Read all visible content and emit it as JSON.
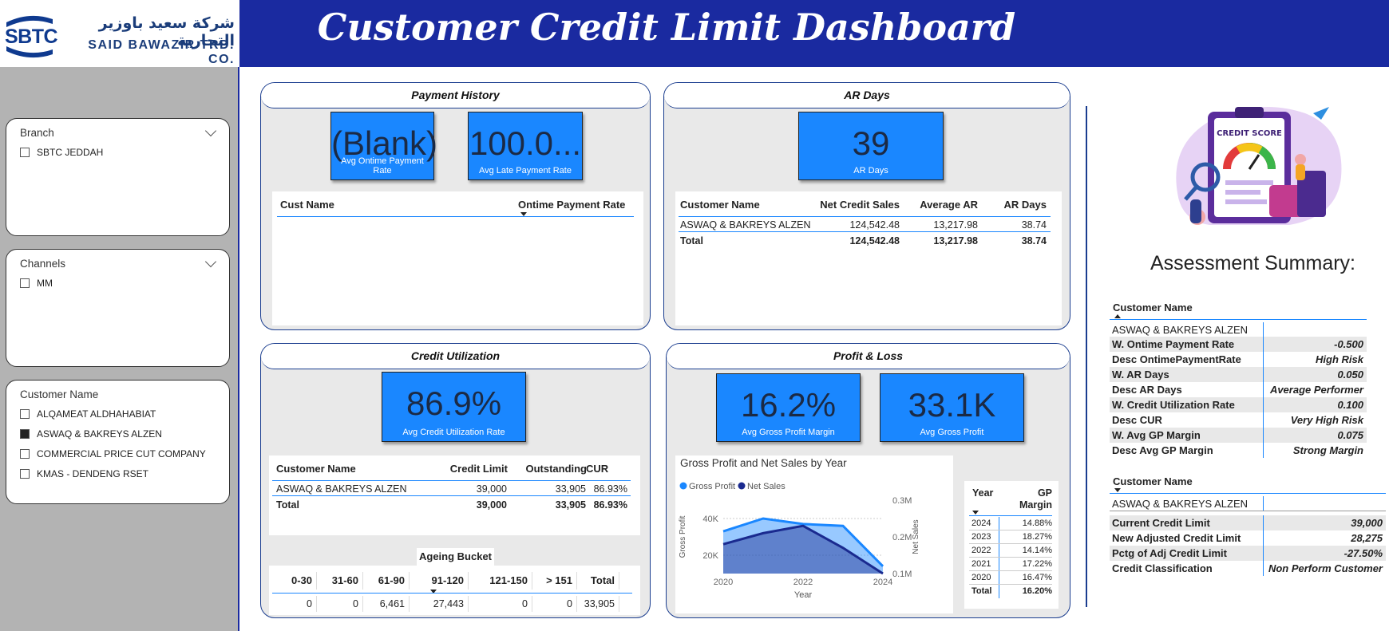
{
  "header": {
    "title": "Customer Credit Limit Dashboard",
    "logo_short": "SBTC",
    "logo_arabic": "شركة سعيد باوزير التجارية",
    "logo_english": "SAID BAWAZIR TRD. CO.",
    "brand_color": "#1a2aa0",
    "accent_color": "#1a87ff"
  },
  "slicers": {
    "branch": {
      "title": "Branch",
      "items": [
        {
          "label": "SBTC JEDDAH",
          "checked": false
        }
      ]
    },
    "channels": {
      "title": "Channels",
      "items": [
        {
          "label": "MM",
          "checked": false
        }
      ]
    },
    "customer": {
      "title": "Customer Name",
      "items": [
        {
          "label": "ALQAMEAT ALDHAHABIAT",
          "checked": false
        },
        {
          "label": "ASWAQ & BAKREYS ALZEN",
          "checked": true
        },
        {
          "label": "COMMERCIAL PRICE CUT COMPANY",
          "checked": false
        },
        {
          "label": "KMAS - DENDENG RSET",
          "checked": false
        }
      ]
    }
  },
  "payment_history": {
    "title": "Payment History",
    "kpi1": {
      "value": "(Blank)",
      "label": "Avg Ontime Payment Rate"
    },
    "kpi2": {
      "value": "100.0...",
      "label": "Avg Late Payment Rate"
    },
    "table": {
      "col1": "Cust Name",
      "col2": "Ontime Payment Rate"
    }
  },
  "ar_days": {
    "title": "AR Days",
    "kpi": {
      "value": "39",
      "label": "AR Days"
    },
    "table": {
      "headers": [
        "Customer Name",
        "Net Credit Sales",
        "Average AR",
        "AR Days"
      ],
      "row": [
        "ASWAQ & BAKREYS ALZEN",
        "124,542.48",
        "13,217.98",
        "38.74"
      ],
      "total": [
        "Total",
        "124,542.48",
        "13,217.98",
        "38.74"
      ]
    }
  },
  "credit_utilization": {
    "title": "Credit Utilization",
    "kpi": {
      "value": "86.9%",
      "label": "Avg Credit Utilization Rate"
    },
    "table": {
      "headers": [
        "Customer Name",
        "Credit Limit",
        "Outstanding",
        "CUR"
      ],
      "row": [
        "ASWAQ & BAKREYS ALZEN",
        "39,000",
        "33,905",
        "86.93%"
      ],
      "total": [
        "Total",
        "39,000",
        "33,905",
        "86.93%"
      ]
    },
    "ageing": {
      "title": "Ageing Bucket",
      "headers": [
        "0-30",
        "31-60",
        "61-90",
        "91-120",
        "121-150",
        "> 151",
        "Total"
      ],
      "values": [
        "0",
        "0",
        "6,461",
        "27,443",
        "0",
        "0",
        "33,905"
      ]
    }
  },
  "profit_loss": {
    "title": "Profit & Loss",
    "kpi1": {
      "value": "16.2%",
      "label": "Avg Gross Profit Margin"
    },
    "kpi2": {
      "value": "33.1K",
      "label": "Avg Gross Profit"
    },
    "gp_table": {
      "headers": [
        "Year",
        "GP Margin"
      ],
      "rows": [
        [
          "2024",
          "14.88%"
        ],
        [
          "2023",
          "18.27%"
        ],
        [
          "2022",
          "14.14%"
        ],
        [
          "2021",
          "17.22%"
        ],
        [
          "2020",
          "16.47%"
        ]
      ],
      "total": [
        "Total",
        "16.20%"
      ]
    }
  },
  "chart_data": {
    "type": "area",
    "title": "Gross Profit and Net Sales by Year",
    "x": [
      2020,
      2021,
      2022,
      2023,
      2024
    ],
    "xlabel": "Year",
    "ylabel_left": "Gross Profit",
    "ylabel_right": "Net Sales",
    "x_ticks": [
      "2020",
      "2022",
      "2024"
    ],
    "y_left_ticks": [
      "20K",
      "40K"
    ],
    "y_left_tick_values": [
      20000,
      40000
    ],
    "y_right_ticks": [
      "0.1M",
      "0.2M",
      "0.3M"
    ],
    "y_right_tick_values": [
      100000,
      200000,
      300000
    ],
    "ylim_left": [
      10000,
      50000
    ],
    "ylim_right": [
      100000,
      300000
    ],
    "legend_position": "top-left",
    "series": [
      {
        "name": "Gross Profit",
        "axis": "left",
        "color": "#1a87ff",
        "values": [
          33000,
          40000,
          37000,
          36000,
          14000
        ]
      },
      {
        "name": "Net Sales",
        "axis": "right",
        "color": "#1a2a8f",
        "values": [
          180000,
          210000,
          230000,
          170000,
          100000
        ]
      }
    ]
  },
  "summary": {
    "title": "Assessment Summary:",
    "illustration_label": "CREDIT SCORE",
    "block1": {
      "header": "Customer Name",
      "customer": "ASWAQ & BAKREYS ALZEN",
      "rows": [
        [
          "W. Ontime Payment Rate",
          "-0.500"
        ],
        [
          "Desc OntimePaymentRate",
          "High Risk"
        ],
        [
          "W. AR Days",
          "0.050"
        ],
        [
          "Desc AR Days",
          "Average Performer"
        ],
        [
          "W. Credit Utilization Rate",
          "0.100"
        ],
        [
          "Desc CUR",
          "Very High Risk"
        ],
        [
          "W. Avg GP Margin",
          "0.075"
        ],
        [
          "Desc Avg GP Margin",
          "Strong Margin"
        ]
      ]
    },
    "block2": {
      "header": "Customer Name",
      "customer": "ASWAQ & BAKREYS ALZEN",
      "rows": [
        [
          "Current Credit Limit",
          "39,000"
        ],
        [
          "New Adjusted Credit Limit",
          "28,275"
        ],
        [
          "Pctg of Adj Credit Limit",
          "-27.50%"
        ],
        [
          "Credit Classification",
          "Non Perform Customer"
        ]
      ]
    }
  }
}
